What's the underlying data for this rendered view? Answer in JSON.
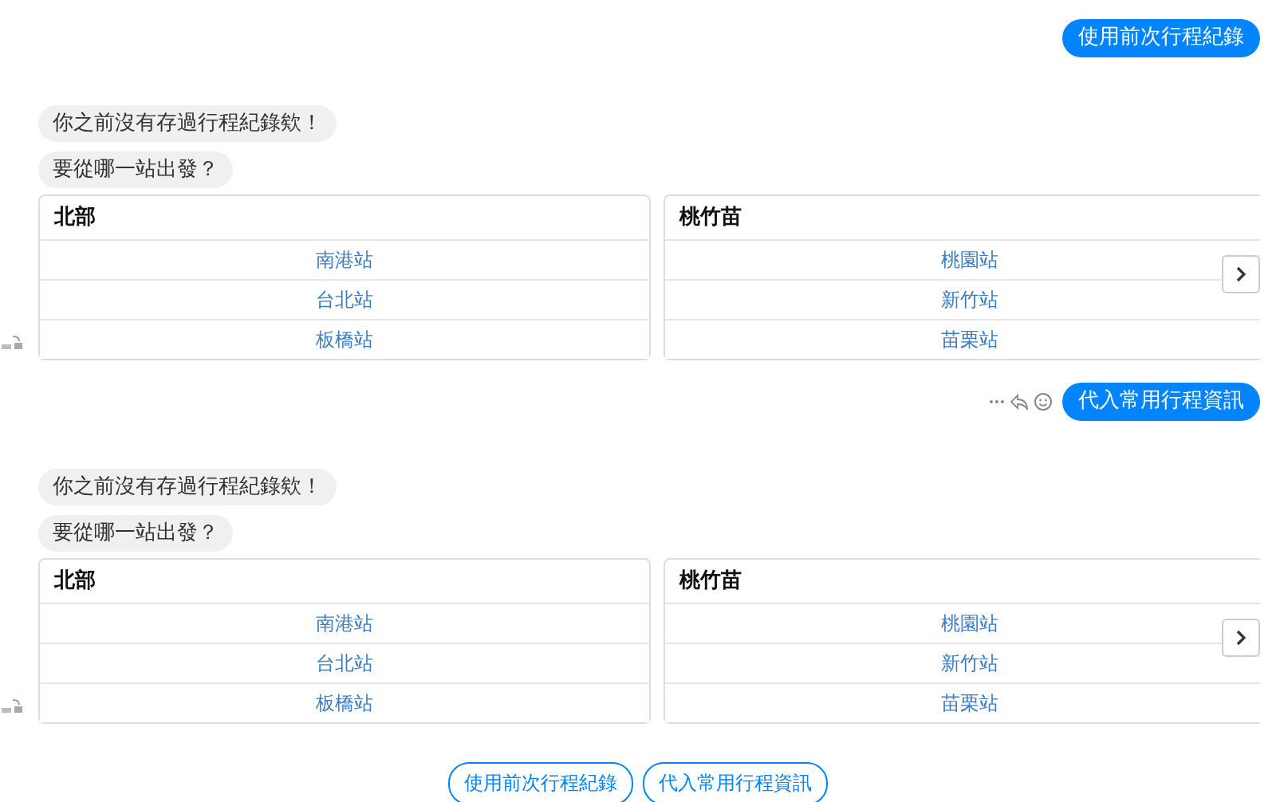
{
  "messages": [
    {
      "kind": "user",
      "text": "使用前次行程紀錄",
      "actions": false
    },
    {
      "kind": "bot",
      "bubbles": [
        "你之前沒有存過行程紀錄欸！",
        "要從哪一站出發？"
      ],
      "cards": [
        {
          "title": "北部",
          "options": [
            "南港站",
            "台北站",
            "板橋站"
          ]
        },
        {
          "title": "桃竹苗",
          "options": [
            "桃園站",
            "新竹站",
            "苗栗站"
          ]
        }
      ]
    },
    {
      "kind": "user",
      "text": "代入常用行程資訊",
      "actions": true
    },
    {
      "kind": "bot",
      "bubbles": [
        "你之前沒有存過行程紀錄欸！",
        "要從哪一站出發？"
      ],
      "cards": [
        {
          "title": "北部",
          "options": [
            "南港站",
            "台北站",
            "板橋站"
          ]
        },
        {
          "title": "桃竹苗",
          "options": [
            "桃園站",
            "新竹站",
            "苗栗站"
          ]
        }
      ]
    }
  ],
  "quick_replies": [
    "使用前次行程紀錄",
    "代入常用行程資訊"
  ]
}
